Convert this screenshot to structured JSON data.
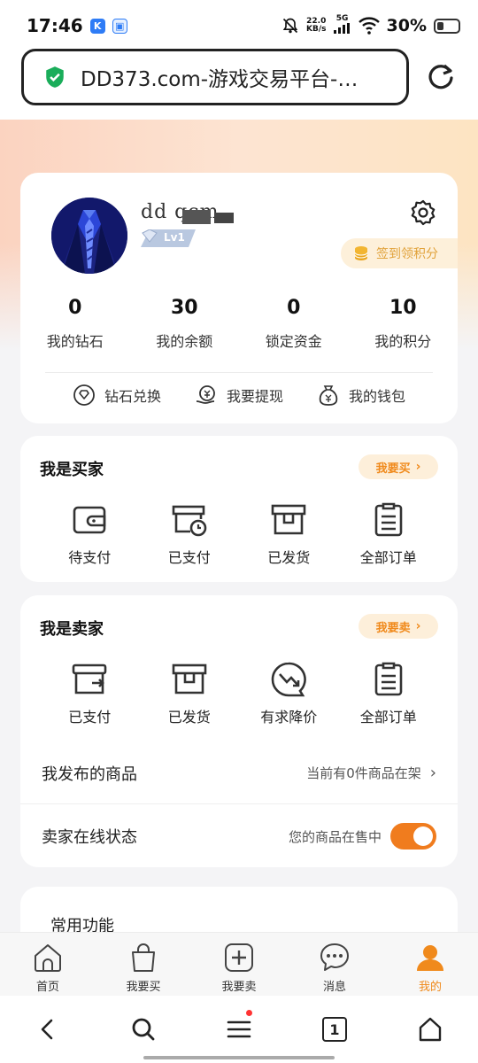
{
  "status": {
    "time": "17:46",
    "net_speed": "22.0",
    "net_unit": "KB/s",
    "net_type": "5G",
    "battery": "30%",
    "battery_level": 0.3
  },
  "browser": {
    "url_title": "DD373.com-游戏交易平台-…"
  },
  "profile": {
    "username": "dd  qcm",
    "level": "Lv1",
    "signin_label": "签到领积分",
    "stats": [
      {
        "value": "0",
        "label": "我的钻石"
      },
      {
        "value": "30",
        "label": "我的余额"
      },
      {
        "value": "0",
        "label": "锁定资金"
      },
      {
        "value": "10",
        "label": "我的积分"
      }
    ],
    "quick": [
      {
        "label": "钻石兑换",
        "icon": "diamond-exchange-icon"
      },
      {
        "label": "我要提现",
        "icon": "withdraw-icon"
      },
      {
        "label": "我的钱包",
        "icon": "wallet-bag-icon"
      }
    ]
  },
  "buyer": {
    "title": "我是买家",
    "action": "我要买",
    "items": [
      {
        "label": "待支付",
        "icon": "wallet-icon"
      },
      {
        "label": "已支付",
        "icon": "paid-clock-icon"
      },
      {
        "label": "已发货",
        "icon": "box-icon"
      },
      {
        "label": "全部订单",
        "icon": "order-list-icon"
      }
    ]
  },
  "seller": {
    "title": "我是卖家",
    "action": "我要卖",
    "items": [
      {
        "label": "已支付",
        "icon": "paid-arrow-icon"
      },
      {
        "label": "已发货",
        "icon": "box-icon"
      },
      {
        "label": "有求降价",
        "icon": "price-down-chat-icon"
      },
      {
        "label": "全部订单",
        "icon": "order-list-icon"
      }
    ],
    "published_label": "我发布的商品",
    "published_value": "当前有0件商品在架",
    "online_label": "卖家在线状态",
    "online_value": "您的商品在售中",
    "online_on": true
  },
  "common": {
    "title": "常用功能"
  },
  "tabs": [
    {
      "label": "首页",
      "icon": "home-icon",
      "active": false
    },
    {
      "label": "我要买",
      "icon": "shopping-bag-icon",
      "active": false
    },
    {
      "label": "我要卖",
      "icon": "add-icon",
      "active": false
    },
    {
      "label": "消息",
      "icon": "message-icon",
      "active": false
    },
    {
      "label": "我的",
      "icon": "profile-icon",
      "active": true
    }
  ],
  "browser_nav": {
    "tab_count": "1"
  },
  "colors": {
    "accent": "#f08a1c",
    "pill_bg": "#fdefda",
    "secure_green": "#1aad5a"
  }
}
